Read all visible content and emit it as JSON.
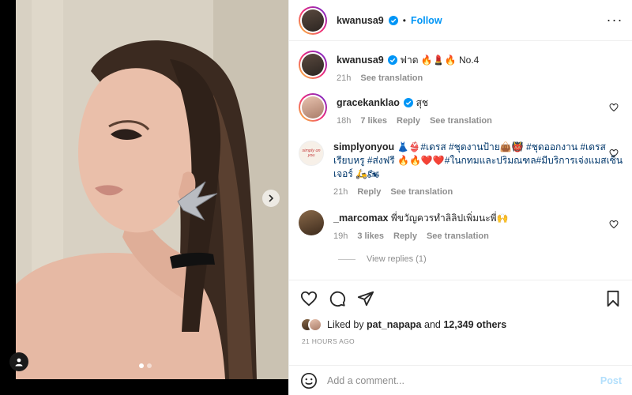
{
  "post": {
    "author": "kwanusa9",
    "follow_label": "Follow",
    "more_label": "···",
    "dot_separator": "•",
    "icons": {
      "verified": "verified-badge-icon",
      "more": "more-options-icon",
      "next": "chevron-right-icon",
      "tag": "user-tag-icon",
      "like": "heart-icon",
      "comment": "comment-bubble-icon",
      "share": "paper-plane-icon",
      "save": "bookmark-icon",
      "emoji": "smiley-icon"
    },
    "colors": {
      "accent": "#0095f6",
      "link": "#00376b",
      "muted": "#8e8e8e",
      "post_disabled": "#b2dffc"
    },
    "carousel": {
      "slide_count": 2,
      "active_index": 0
    }
  },
  "caption": {
    "username": "kwanusa9",
    "text": "ฟาด 🔥💄🔥 No.4",
    "time": "21h",
    "translate": "See translation"
  },
  "comments": [
    {
      "username": "gracekanklao",
      "text": "สุช",
      "time": "18h",
      "likes": "7 likes",
      "reply": "Reply",
      "translate": "See translation"
    },
    {
      "username": "simplyonyou",
      "avatar_text": "simply on you",
      "text_pre": "👗👙",
      "text": "#เดรส #ชุดงานป้าย👜👹 #ชุดออกงาน #เดรสเรียบหรู #ส่งฟรี 🔥🔥❤️❤️#ในกทมและปริมณฑล#มีบริการเจ่งแมสเซ็นเจอร์ 🛵🏍",
      "time": "21h",
      "reply": "Reply",
      "translate": "See translation"
    },
    {
      "username": "_marcomax",
      "text": "พี่ขวัญควรทำลิลิปเพิ่มนะพี่🙌",
      "time": "19h",
      "likes": "3 likes",
      "reply": "Reply",
      "translate": "See translation",
      "view_replies": "View replies (1)"
    }
  ],
  "likes": {
    "prefix": "Liked by",
    "user": "pat_napapa",
    "and": "and",
    "others": "12,349 others"
  },
  "timestamp": "21 HOURS AGO",
  "add_comment": {
    "placeholder": "Add a comment...",
    "post_label": "Post"
  }
}
